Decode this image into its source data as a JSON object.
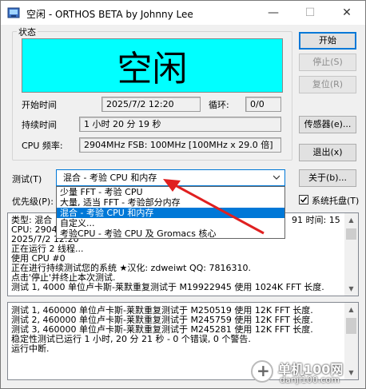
{
  "window": {
    "title": "空闲 - ORTHOS BETA by Johnny Lee",
    "minimize_glyph": "—",
    "maximize_glyph": "☐",
    "close_glyph": "✕"
  },
  "status_group": {
    "label": "状态",
    "status_text": "空闲",
    "status_color": "#00ffff"
  },
  "info": {
    "start_time_label": "开始时间",
    "start_time_value": "2025/7/2 12:20",
    "loop_label": "循环:",
    "loop_value": "0/0",
    "duration_label": "持续时间",
    "duration_value": "1 小时 20 分 19 秒",
    "cpu_freq_label": "CPU 频率:",
    "cpu_freq_value": "2904MHz FSB: 100MHz [100MHz x 29.0 倍]"
  },
  "buttons": {
    "start": "开始",
    "stop": "停止(S)",
    "reset": "复位(R)",
    "sensors": "传感器(e)...",
    "exit": "退出(x)",
    "about": "关于(b)..."
  },
  "test": {
    "label": "测试(T)",
    "selected": "混合 - 考验 CPU 和内存",
    "options": [
      "少量 FFT - 考验 CPU",
      "大量, 适当 FFT - 考验部分内存",
      "混合 - 考验 CPU 和内存",
      "自定义...",
      "考验CPU - 考验 CPU 及 Gromacs 核心"
    ],
    "highlighted_index": 2
  },
  "priority": {
    "label": "优先级(P):"
  },
  "tray": {
    "label": "系统托盘(T)",
    "checked": true
  },
  "log_top": {
    "lines": [
      "类型: 混合",
      "CPU: 2904",
      "2025/7/2 12:20",
      "正在运行 2 线程...",
      "使用 CPU #0",
      "正在进行持续测试您的系统    ★汉化: zdweiwt QQ: 7816310.",
      "点击'停止'并终止本次测试.",
      "测试 1, 4000 单位卢卡斯-莱默重复测试于 M19922945 使用 1024K FFT 长度."
    ],
    "right_fragment": "91 时间: 15"
  },
  "log_bottom": {
    "lines": [
      "测试 1, 460000 单位卢卡斯-莱默重复测试于 M250519 使用 12K FFT 长度.",
      "测试 2, 460000 单位卢卡斯-莱默重复测试于 M245759 使用 12K FFT 长度.",
      "测试 3, 460000 单位卢卡斯-莱默重复测试于 M245281 使用 12K FFT 长度.",
      "稳定性测试已运行 1 小时, 20 分 21 秒 - 0 个错误, 0 个警告.",
      "运行中断."
    ]
  },
  "watermark": {
    "name": "单机100网",
    "url": "danji100.com"
  },
  "annotation_color": "#e02020"
}
